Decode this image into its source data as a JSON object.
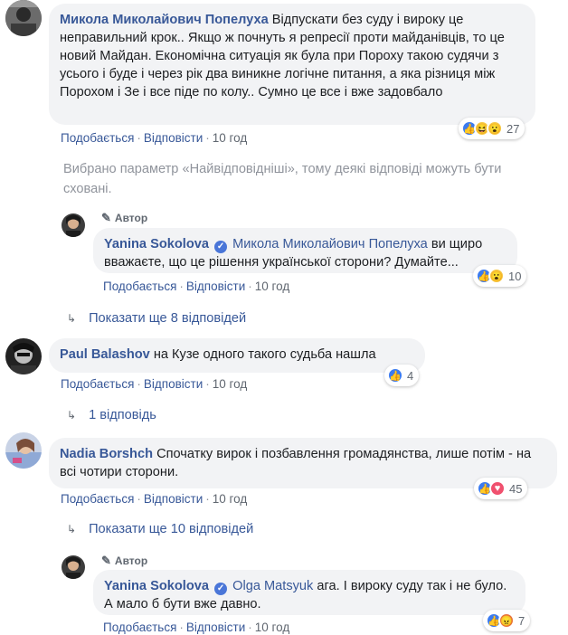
{
  "action_labels": {
    "like": "Подобається",
    "reply": "Відповісти"
  },
  "notice": "Вибрано параметр «Найвідповідніші», тому деякі відповіді можуть бути сховані.",
  "comments": [
    {
      "author": "Микола Миколайович Попелуха",
      "text": "Відпускати без суду і вироку це неправильний крок.. Якщо ж почнуть я репресії проти майданівців, то це новий Майдан. Економічна ситуація як була при Пороху такою судячи з усього і буде і через рік два виникне логічне питання, а яка різниця між Порохом і Зе і все піде по колу.. Сумно це все і вже задовбало",
      "time": "10 год",
      "reactions": [
        "like",
        "haha",
        "wow"
      ],
      "reaction_count": "27"
    },
    {
      "badge": "Автор",
      "author": "Yanina Sokolova",
      "mention": "Микола Миколайович Попелуха",
      "text": "ви щиро вважаєте, що це рішення української сторони? Думайте...",
      "time": "10 год",
      "reactions": [
        "like",
        "wow"
      ],
      "reaction_count": "10"
    },
    {
      "author": "Paul Balashov",
      "text": "на Кузе одного такого судьба нашла",
      "time": "10 год",
      "reactions": [
        "like"
      ],
      "reaction_count": "4"
    },
    {
      "author": "Nadia Borshch",
      "text": "Спочатку вирок і позбавлення громадянства, лише потім - на всі чотири сторони.",
      "time": "10 год",
      "reactions": [
        "like",
        "love"
      ],
      "reaction_count": "45"
    },
    {
      "badge": "Автор",
      "author": "Yanina Sokolova",
      "mention": "Olga Matsyuk",
      "text": "ага. І вироку суду так і не було. А мало б бути вже давно.",
      "time": "10 год",
      "reactions": [
        "like",
        "angry"
      ],
      "reaction_count": "7"
    }
  ],
  "more_replies": [
    "Показати ще 8 відповідей",
    "1 відповідь",
    "Показати ще 10 відповідей"
  ]
}
